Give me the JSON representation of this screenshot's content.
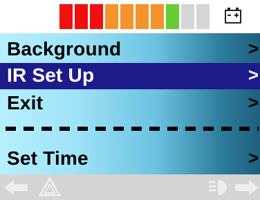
{
  "status_bar": {
    "battery_gauge": {
      "level": 0.8,
      "segments": [
        {
          "color": "#f01010"
        },
        {
          "color": "#f01010"
        },
        {
          "color": "#f01010"
        },
        {
          "color": "#f4932a"
        },
        {
          "color": "#f4932a"
        },
        {
          "color": "#f4932a"
        },
        {
          "color": "#f4932a"
        },
        {
          "color": "#66cc33"
        },
        {
          "color": "#d6d6d6"
        },
        {
          "color": "#d6d6d6"
        }
      ]
    },
    "battery_icon": "battery-plus-minus-icon"
  },
  "menu": {
    "items": [
      {
        "label": "Background",
        "arrow": ">"
      },
      {
        "label": "IR Set Up",
        "arrow": ">",
        "selected": true
      },
      {
        "label": "Exit",
        "arrow": ">"
      },
      {
        "label": "Set Time",
        "arrow": ">"
      }
    ]
  },
  "bottom_bar": {
    "left_icon": "arrow-left-icon",
    "hazard_icon": "hazard-triangle-icon",
    "lights_icon": "headlight-icon",
    "right_icon": "arrow-right-icon"
  },
  "colors": {
    "selection": "#1d1b8a",
    "panel_gradient_light": "#b6f0ff",
    "panel_gradient_dark": "#1e5f7d",
    "bottom_bar": "#d4d4d4"
  }
}
